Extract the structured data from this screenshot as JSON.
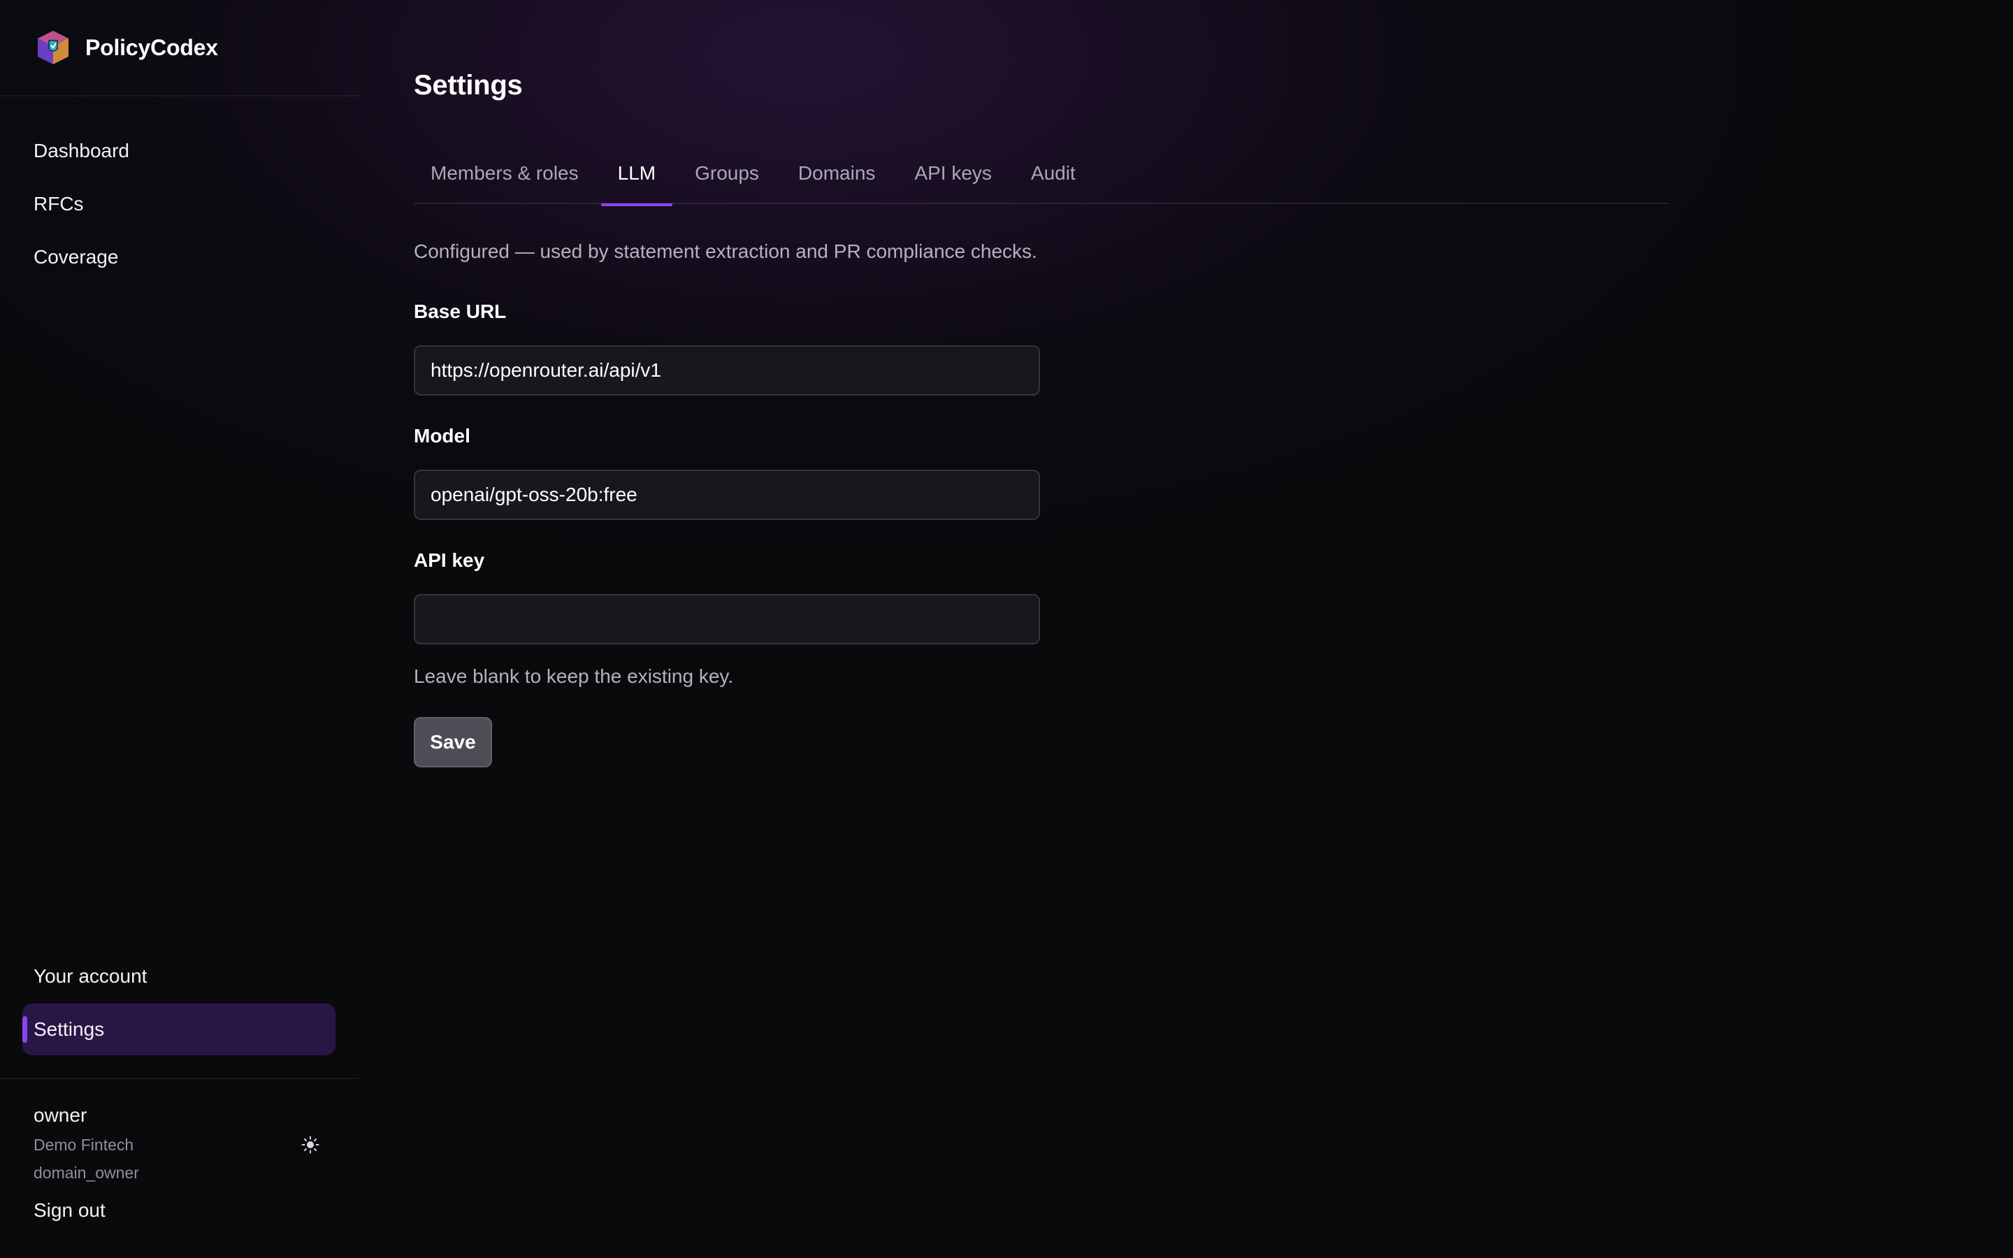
{
  "app": {
    "name": "PolicyCodex",
    "logo_icon": "cube-shield-logo-icon"
  },
  "sidebar": {
    "items": [
      {
        "label": "Dashboard"
      },
      {
        "label": "RFCs"
      },
      {
        "label": "Coverage"
      }
    ],
    "bottom_items": [
      {
        "label": "Your account",
        "active": false
      },
      {
        "label": "Settings",
        "active": true
      }
    ],
    "user": {
      "name": "owner",
      "org": "Demo Fintech",
      "role": "domain_owner",
      "theme_icon": "sun-icon"
    },
    "signout_label": "Sign out"
  },
  "main": {
    "title": "Settings",
    "tabs": [
      {
        "label": "Members & roles",
        "active": false
      },
      {
        "label": "LLM",
        "active": true
      },
      {
        "label": "Groups",
        "active": false
      },
      {
        "label": "Domains",
        "active": false
      },
      {
        "label": "API keys",
        "active": false
      },
      {
        "label": "Audit",
        "active": false
      }
    ],
    "llm": {
      "description": "Configured — used by statement extraction and PR compliance checks.",
      "base_url_label": "Base URL",
      "base_url_value": "https://openrouter.ai/api/v1",
      "model_label": "Model",
      "model_value": "openai/gpt-oss-20b:free",
      "api_key_label": "API key",
      "api_key_value": "",
      "hint": "Leave blank to keep the existing key.",
      "save_label": "Save"
    }
  },
  "colors": {
    "accent": "#8b45f0",
    "active_bg": "#2a1547",
    "background": "#0a0a0d"
  }
}
